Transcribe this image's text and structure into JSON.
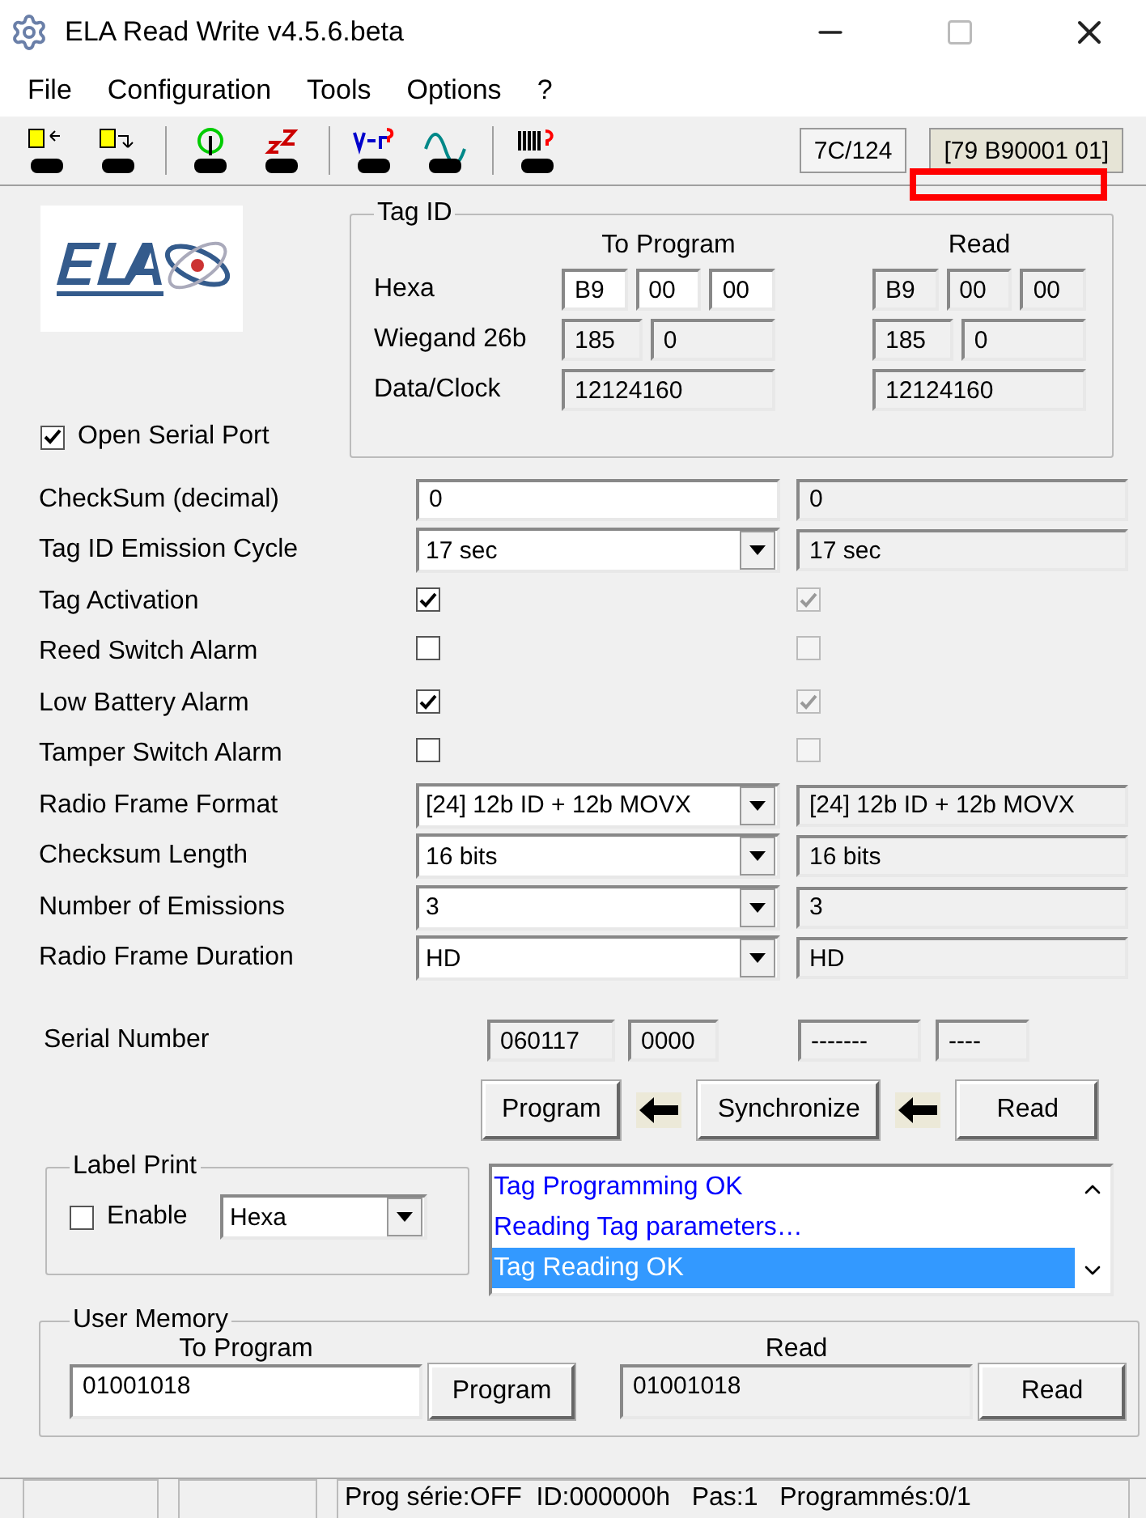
{
  "window": {
    "title": "ELA Read Write v4.5.6.beta"
  },
  "menu": [
    "File",
    "Configuration",
    "Tools",
    "Options",
    "?"
  ],
  "toolbar": {
    "fields": [
      "7C/124",
      "[79 B90001 01]"
    ]
  },
  "open_serial_port": {
    "label": "Open Serial Port",
    "checked": true
  },
  "tag_id": {
    "title": "Tag ID",
    "columns": [
      "To Program",
      "Read"
    ],
    "rows": [
      {
        "label": "Hexa",
        "editable": true,
        "program": [
          "B9",
          "00",
          "00"
        ],
        "read": [
          "B9",
          "00",
          "00"
        ]
      },
      {
        "label": "Wiegand 26b",
        "editable": false,
        "program": [
          "185",
          "0"
        ],
        "read": [
          "185",
          "0"
        ]
      },
      {
        "label": "Data/Clock",
        "editable": false,
        "program": [
          "12124160"
        ],
        "read": [
          "12124160"
        ]
      }
    ]
  },
  "parameters": [
    {
      "kind": "text",
      "label": "CheckSum (decimal)",
      "program": "0",
      "read": "0"
    },
    {
      "kind": "select",
      "label": "Tag ID Emission Cycle",
      "program": "17 sec",
      "read": "17 sec"
    },
    {
      "kind": "check",
      "label": "Tag Activation",
      "program_checked": true,
      "read_checked": true
    },
    {
      "kind": "check",
      "label": "Reed Switch Alarm",
      "program_checked": false,
      "read_checked": false
    },
    {
      "kind": "check",
      "label": "Low Battery Alarm",
      "program_checked": true,
      "read_checked": true
    },
    {
      "kind": "check",
      "label": "Tamper Switch Alarm",
      "program_checked": false,
      "read_checked": false
    },
    {
      "kind": "select",
      "label": "Radio Frame Format",
      "program": "[24]  12b ID + 12b MOVX",
      "read": "[24]  12b ID + 12b MOVX"
    },
    {
      "kind": "select",
      "label": "Checksum Length",
      "program": "16 bits",
      "read": "16 bits"
    },
    {
      "kind": "select",
      "label": "Number of Emissions",
      "program": "3",
      "read": "3"
    },
    {
      "kind": "select",
      "label": "Radio Frame Duration",
      "program": "HD",
      "read": "HD"
    }
  ],
  "serial_number": {
    "label": "Serial Number",
    "program": [
      "060117",
      "0000"
    ],
    "read": [
      "-------",
      "----"
    ]
  },
  "actions": [
    "Program",
    "Synchronize",
    "Read"
  ],
  "label_print": {
    "title": "Label Print",
    "enable": {
      "label": "Enable",
      "checked": false
    },
    "format": "Hexa"
  },
  "log": [
    {
      "text": "Tag Programming OK",
      "selected": false
    },
    {
      "text": "Reading Tag parameters…",
      "selected": false
    },
    {
      "text": "Tag Reading OK",
      "selected": true
    }
  ],
  "user_memory": {
    "title": "User Memory",
    "program_label": "To Program",
    "program_value": "01001018",
    "program_button": "Program",
    "read_label": "Read",
    "read_value": "01001018",
    "read_button": "Read"
  },
  "status_bar": {
    "text": "Prog série:OFF  ID:000000h   Pas:1   Programmés:0/1"
  }
}
